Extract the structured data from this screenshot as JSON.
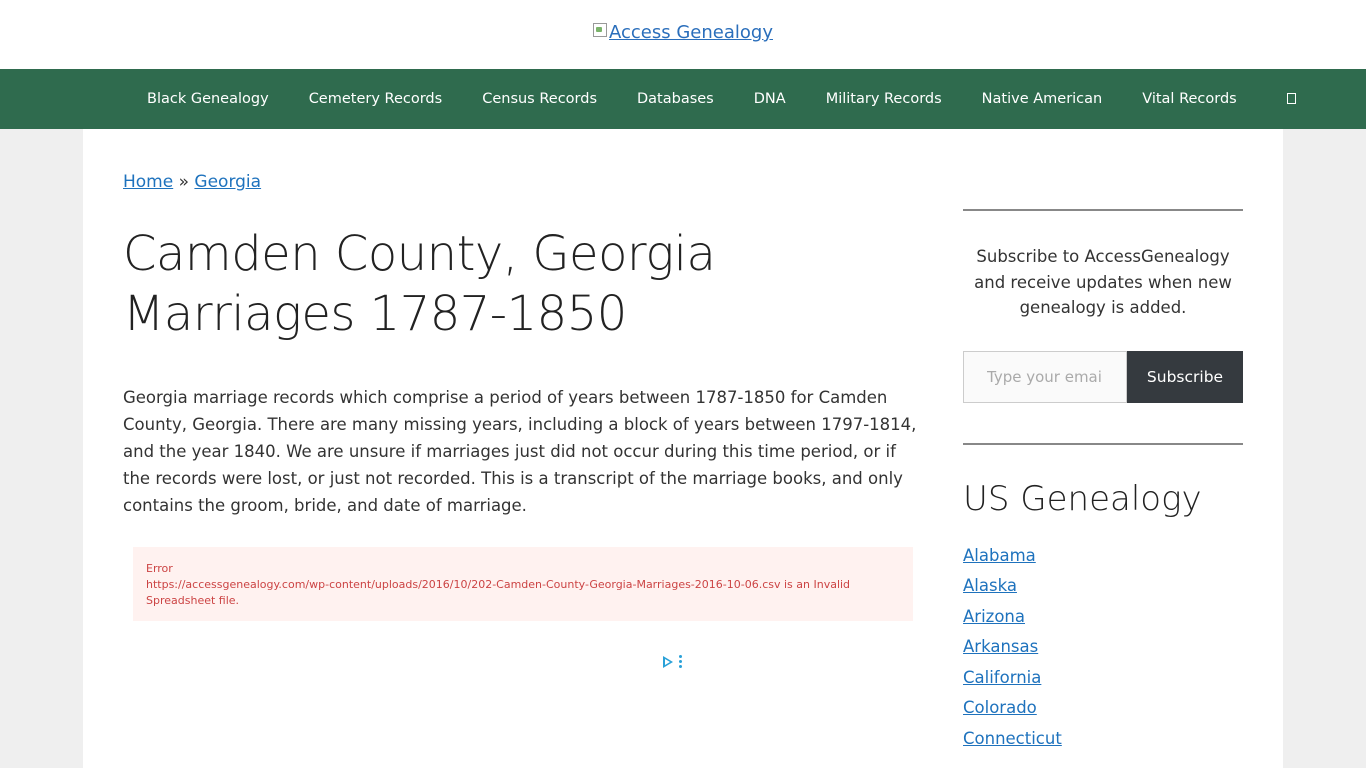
{
  "header": {
    "logo_alt": "Access Genealogy"
  },
  "nav": {
    "items": [
      "Black Genealogy",
      "Cemetery Records",
      "Census Records",
      "Databases",
      "DNA",
      "Military Records",
      "Native American",
      "Vital Records"
    ]
  },
  "breadcrumb": {
    "home": "Home",
    "separator": "»",
    "current": "Georgia"
  },
  "article": {
    "title": "Camden County, Georgia Marriages 1787-1850",
    "intro": "Georgia marriage records which comprise a period of years between 1787-1850 for Camden County, Georgia. There are many missing years, including a block of years between 1797-1814, and the year 1840. We are unsure if marriages just did not occur during this time period, or if the records were lost, or just not recorded. This is a transcript of the marriage books, and only contains the groom, bride, and date of marriage.",
    "error_title": "Error",
    "error_message": "https://accessgenealogy.com/wp-content/uploads/2016/10/202-Camden-County-Georgia-Marriages-2016-10-06.csv is an Invalid Spreadsheet file."
  },
  "sidebar": {
    "subscribe_text": "Subscribe to AccessGenealogy and receive updates when new genealogy is added.",
    "email_placeholder": "Type your email.",
    "subscribe_label": "Subscribe",
    "widget_title": "US Genealogy",
    "states": [
      "Alabama",
      "Alaska",
      "Arizona",
      "Arkansas",
      "California",
      "Colorado",
      "Connecticut"
    ]
  },
  "colors": {
    "nav_bg": "#2f6b4e",
    "link": "#1e72bd",
    "error_bg": "#fff2f0",
    "error_text": "#c44444",
    "button_bg": "#353a3f"
  }
}
